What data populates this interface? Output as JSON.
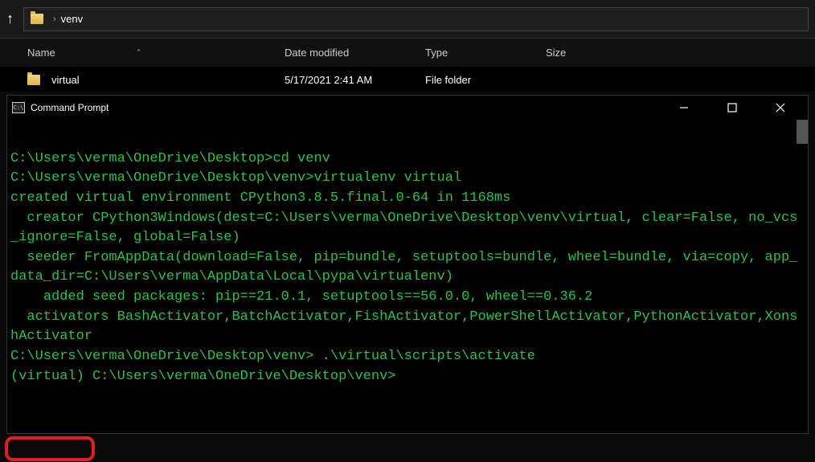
{
  "address_bar": {
    "path_segment": "venv"
  },
  "columns": {
    "name": "Name",
    "date": "Date modified",
    "type": "Type",
    "size": "Size"
  },
  "rows": [
    {
      "name": "virtual",
      "date": "5/17/2021 2:41 AM",
      "type": "File folder",
      "size": ""
    }
  ],
  "terminal": {
    "title": "Command Prompt",
    "lines": {
      "l1": "C:\\Users\\verma\\OneDrive\\Desktop>cd venv",
      "l2": "",
      "l3": "C:\\Users\\verma\\OneDrive\\Desktop\\venv>virtualenv virtual",
      "l4": "created virtual environment CPython3.8.5.final.0-64 in 1168ms",
      "l5": "  creator CPython3Windows(dest=C:\\Users\\verma\\OneDrive\\Desktop\\venv\\virtual, clear=False, no_vcs_ignore=False, global=False)",
      "l6": "  seeder FromAppData(download=False, pip=bundle, setuptools=bundle, wheel=bundle, via=copy, app_data_dir=C:\\Users\\verma\\AppData\\Local\\pypa\\virtualenv)",
      "l7": "    added seed packages: pip==21.0.1, setuptools==56.0.0, wheel==0.36.2",
      "l8": "  activators BashActivator,BatchActivator,FishActivator,PowerShellActivator,PythonActivator,XonshActivator",
      "l9": "",
      "l10": "C:\\Users\\verma\\OneDrive\\Desktop\\venv> .\\virtual\\scripts\\activate",
      "l11": "",
      "l12": "(virtual) C:\\Users\\verma\\OneDrive\\Desktop\\venv>"
    }
  }
}
